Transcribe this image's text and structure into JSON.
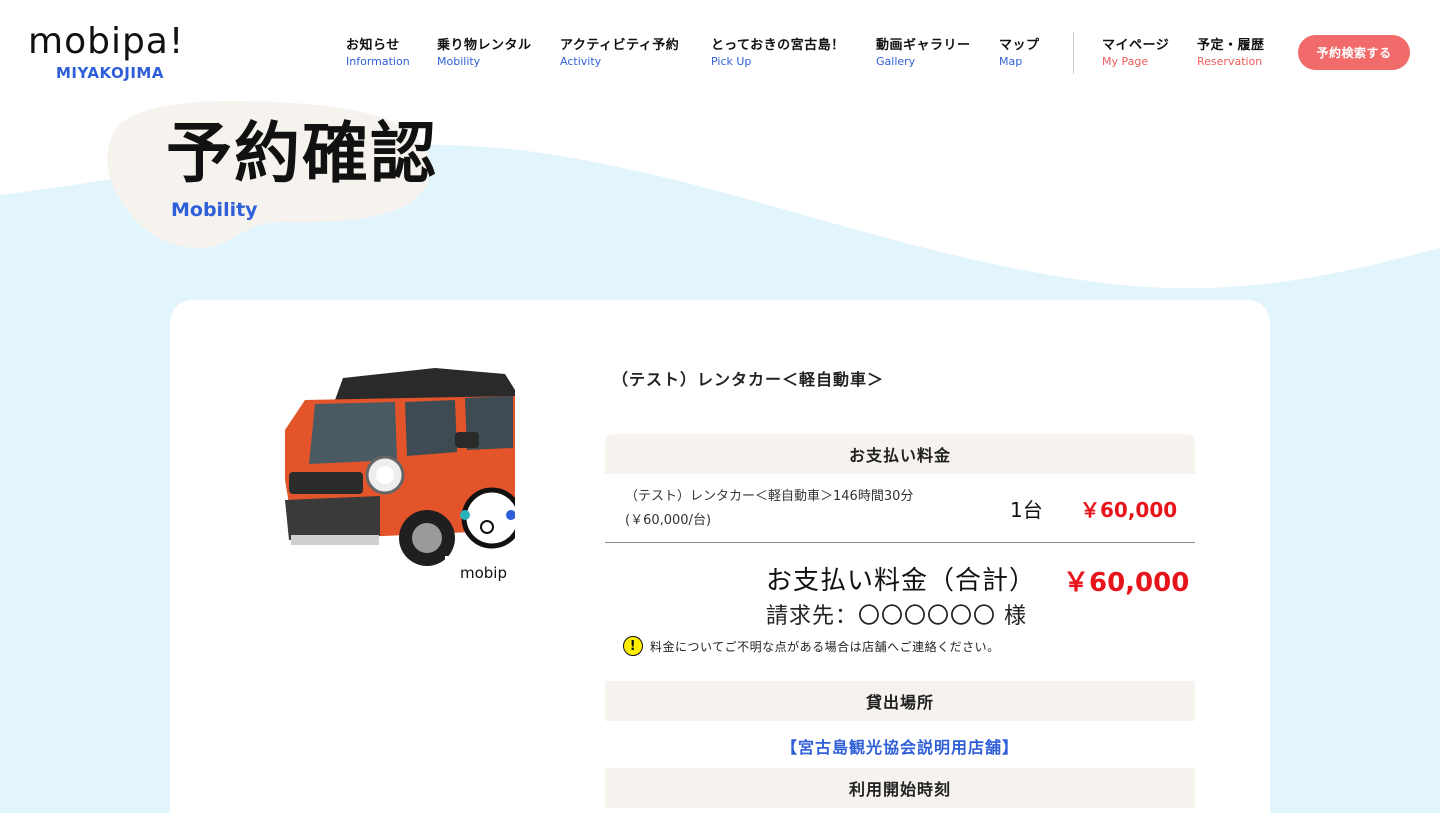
{
  "header": {
    "logo": "mobipa!",
    "logo_sub": "MIYAKOJIMA",
    "nav": [
      {
        "jp": "お知らせ",
        "en": "Information"
      },
      {
        "jp": "乗り物レンタル",
        "en": "Mobility"
      },
      {
        "jp": "アクティビティ予約",
        "en": "Activity"
      },
      {
        "jp": "とっておきの宮古島！",
        "en": "Pick Up"
      },
      {
        "jp": "動画ギャラリー",
        "en": "Gallery"
      },
      {
        "jp": "マップ",
        "en": "Map"
      }
    ],
    "nav_user": [
      {
        "jp": "マイページ",
        "en": "My Page"
      },
      {
        "jp": "予定・履歴",
        "en": "Reservation"
      }
    ],
    "search_button": "予約検索する"
  },
  "page": {
    "title": "予約確認",
    "subtitle": "Mobility"
  },
  "booking": {
    "product_name": "（テスト）レンタカー＜軽自動車＞",
    "image_logo_text": "mobip",
    "payment_heading": "お支払い料金",
    "line_desc": "（テスト）レンタカー＜軽自動車＞146時間30分",
    "line_unit": "(￥60,000/台)",
    "line_qty": "1台",
    "line_price": "￥60,000",
    "total_label": "お支払い料金（合計）",
    "total_price": "￥60,000",
    "billing": "請求先：〇〇〇〇〇〇 様",
    "notice": "料金についてご不明な点がある場合は店舗へご連絡ください。",
    "place_heading": "貸出場所",
    "place_link": "【宮古島観光協会説明用店舗】",
    "start_heading": "利用開始時刻"
  },
  "colors": {
    "accent_blue": "#2f5fd8",
    "price_red": "#e8141c",
    "button_coral": "#f26b6b",
    "bg_light_blue": "#e3f5fc",
    "section_beige": "#f6f3ef"
  }
}
